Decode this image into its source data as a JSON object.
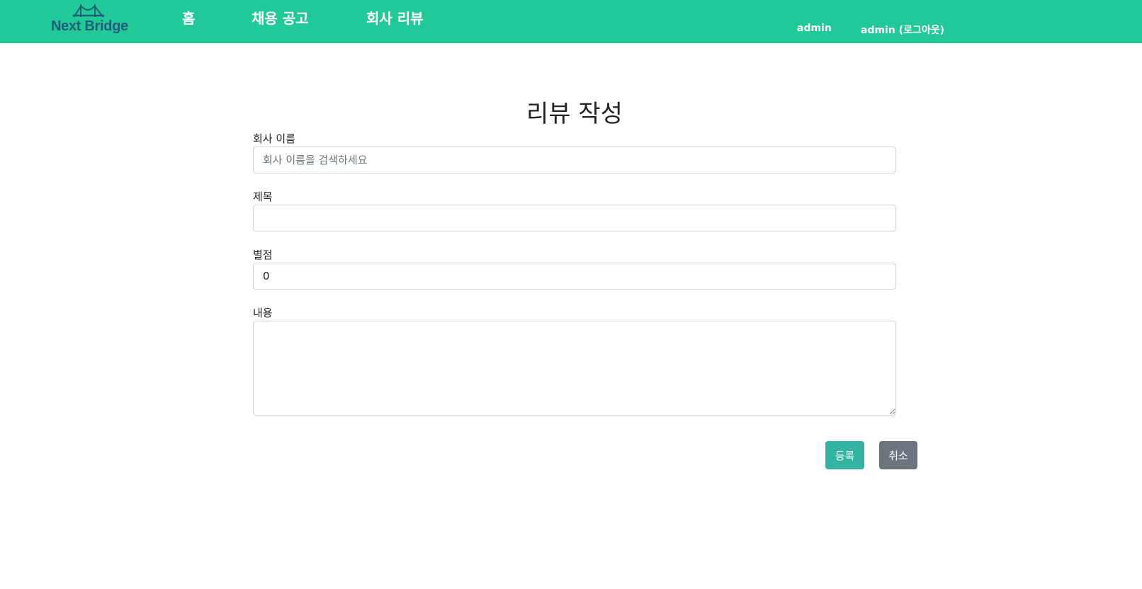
{
  "nav": {
    "logo_text": "Next Bridge",
    "links": [
      "홈",
      "채용 공고",
      "회사 리뷰"
    ],
    "user_name": "admin",
    "logout_label": "admin (로그아웃)"
  },
  "form": {
    "title": "리뷰 작성",
    "company": {
      "label": "회사 이름",
      "placeholder": "회사 이름을 검색하세요",
      "value": ""
    },
    "subject": {
      "label": "제목",
      "value": ""
    },
    "rating": {
      "label": "별점",
      "value": "0"
    },
    "content": {
      "label": "내용",
      "value": ""
    },
    "submit_label": "등록",
    "cancel_label": "취소"
  },
  "colors": {
    "navbar": "#20c997",
    "submit": "#35b3a2",
    "cancel": "#6c757d",
    "logo": "#1d5f7a"
  }
}
